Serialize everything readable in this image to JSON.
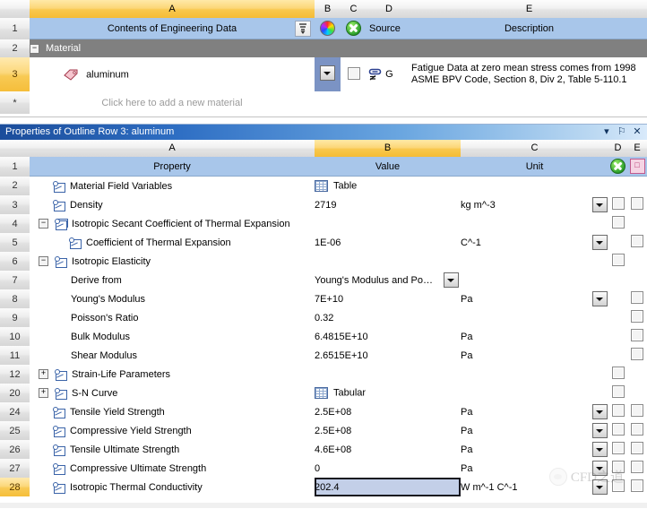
{
  "top_grid": {
    "column_headers": [
      "",
      "A",
      "B",
      "C",
      "D",
      "E"
    ],
    "row_numbers": [
      "1",
      "2",
      "3",
      "*"
    ],
    "header_row": {
      "a": "Contents of Engineering Data",
      "sort_icon": "sort-filter-icon",
      "b_icon": "color-wheel-icon",
      "c_icon": "green-x-circle-icon",
      "d": "Source",
      "e": "Description"
    },
    "group_row": {
      "label": "Material",
      "expander": "−"
    },
    "material_row": {
      "number": "3",
      "icon": "material-tag-icon",
      "name": "aluminum",
      "dropdown_icon": "dropdown-arrow-icon",
      "checkbox_icon": "checkbox-icon",
      "source_icon": "linked-source-icon",
      "source_text": "G",
      "description": "Fatigue Data at zero mean stress comes from 1998 ASME BPV Code, Section 8, Div 2, Table 5-110.1"
    },
    "add_row": {
      "number": "*",
      "label": "Click here to add a new material"
    }
  },
  "properties_panel": {
    "title": "Properties of Outline Row 3: aluminum",
    "title_buttons": [
      "▾",
      "⚐",
      "✕"
    ],
    "title_button_names": [
      "panel-menu-icon",
      "pin-icon",
      "close-icon"
    ],
    "column_headers": [
      "",
      "A",
      "B",
      "C",
      "D",
      "E"
    ],
    "selected_column": "B",
    "header_row": {
      "number": "1",
      "a": "Property",
      "b": "Value",
      "c": "Unit",
      "d_icon": "green-x-circle-icon",
      "e_icon": "pink-chart-icon"
    },
    "rows": [
      {
        "num": "2",
        "indent": 0,
        "expander": "",
        "icon": "property-chart-icon",
        "property": "Material Field Variables",
        "value": "Table",
        "value_icon": "table-icon",
        "unit": "",
        "unit_dropdown": false,
        "d_check": false,
        "e_check": false,
        "selected": false
      },
      {
        "num": "3",
        "indent": 0,
        "expander": "",
        "icon": "property-chart-icon",
        "property": "Density",
        "value": "2719",
        "value_icon": "",
        "unit": "kg m^-3",
        "unit_dropdown": true,
        "d_check": true,
        "e_check": true,
        "selected": false
      },
      {
        "num": "4",
        "indent": 0,
        "expander": "−",
        "icon": "property-chart-double-icon",
        "property": "Isotropic Secant Coefficient of Thermal Expansion",
        "value": "",
        "value_icon": "",
        "unit": "",
        "unit_dropdown": false,
        "d_check": true,
        "e_check": false,
        "selected": false
      },
      {
        "num": "5",
        "indent": 1,
        "expander": "",
        "icon": "property-chart-icon",
        "property": "Coefficient of Thermal Expansion",
        "value": "1E-06",
        "value_icon": "",
        "unit": "C^-1",
        "unit_dropdown": true,
        "d_check": false,
        "e_check": true,
        "selected": false
      },
      {
        "num": "6",
        "indent": 0,
        "expander": "−",
        "icon": "property-chart-icon",
        "property": "Isotropic Elasticity",
        "value": "",
        "value_icon": "",
        "unit": "",
        "unit_dropdown": false,
        "d_check": true,
        "e_check": false,
        "selected": false
      },
      {
        "num": "7",
        "indent": 2,
        "expander": "",
        "icon": "",
        "property": "Derive from",
        "value": "Young's Modulus and Po…",
        "value_icon": "",
        "unit": "",
        "unit_dropdown": false,
        "d_check": false,
        "e_check": false,
        "selected": false,
        "value_combo": true
      },
      {
        "num": "8",
        "indent": 2,
        "expander": "",
        "icon": "",
        "property": "Young's Modulus",
        "value": "7E+10",
        "value_icon": "",
        "unit": "Pa",
        "unit_dropdown": true,
        "d_check": false,
        "e_check": true,
        "selected": false
      },
      {
        "num": "9",
        "indent": 2,
        "expander": "",
        "icon": "",
        "property": "Poisson's Ratio",
        "value": "0.32",
        "value_icon": "",
        "unit": "",
        "unit_dropdown": false,
        "d_check": false,
        "e_check": true,
        "selected": false
      },
      {
        "num": "10",
        "indent": 2,
        "expander": "",
        "icon": "",
        "property": "Bulk Modulus",
        "value": "6.4815E+10",
        "value_icon": "",
        "unit": "Pa",
        "unit_dropdown": false,
        "d_check": false,
        "e_check": true,
        "selected": false
      },
      {
        "num": "11",
        "indent": 2,
        "expander": "",
        "icon": "",
        "property": "Shear Modulus",
        "value": "2.6515E+10",
        "value_icon": "",
        "unit": "Pa",
        "unit_dropdown": false,
        "d_check": false,
        "e_check": true,
        "selected": false
      },
      {
        "num": "12",
        "indent": 0,
        "expander": "+",
        "icon": "property-chart-icon",
        "property": "Strain-Life Parameters",
        "value": "",
        "value_icon": "",
        "unit": "",
        "unit_dropdown": false,
        "d_check": true,
        "e_check": false,
        "selected": false
      },
      {
        "num": "20",
        "indent": 0,
        "expander": "+",
        "icon": "property-chart-icon",
        "property": "S-N Curve",
        "value": "Tabular",
        "value_icon": "table-icon",
        "unit": "",
        "unit_dropdown": false,
        "d_check": true,
        "e_check": false,
        "selected": false
      },
      {
        "num": "24",
        "indent": 0,
        "expander": "",
        "icon": "property-chart-icon",
        "property": "Tensile Yield Strength",
        "value": "2.5E+08",
        "value_icon": "",
        "unit": "Pa",
        "unit_dropdown": true,
        "d_check": true,
        "e_check": true,
        "selected": false
      },
      {
        "num": "25",
        "indent": 0,
        "expander": "",
        "icon": "property-chart-icon",
        "property": "Compressive Yield Strength",
        "value": "2.5E+08",
        "value_icon": "",
        "unit": "Pa",
        "unit_dropdown": true,
        "d_check": true,
        "e_check": true,
        "selected": false
      },
      {
        "num": "26",
        "indent": 0,
        "expander": "",
        "icon": "property-chart-icon",
        "property": "Tensile Ultimate Strength",
        "value": "4.6E+08",
        "value_icon": "",
        "unit": "Pa",
        "unit_dropdown": true,
        "d_check": true,
        "e_check": true,
        "selected": false
      },
      {
        "num": "27",
        "indent": 0,
        "expander": "",
        "icon": "property-chart-icon",
        "property": "Compressive Ultimate Strength",
        "value": "0",
        "value_icon": "",
        "unit": "Pa",
        "unit_dropdown": true,
        "d_check": true,
        "e_check": true,
        "selected": false
      },
      {
        "num": "28",
        "indent": 0,
        "expander": "",
        "icon": "property-chart-icon",
        "property": "Isotropic Thermal Conductivity",
        "value": "202.4",
        "value_icon": "",
        "unit": "W m^-1 C^-1",
        "unit_dropdown": true,
        "d_check": true,
        "e_check": true,
        "selected": true
      }
    ]
  },
  "watermark": {
    "text": "CFD之道",
    "logo": "cfd-logo-icon"
  },
  "colors": {
    "selected_column_header": "#f5c13c",
    "header_row_blue": "#a8c6ea",
    "group_row_gray": "#808080",
    "title_bar_blue": "#1b4d9b",
    "selected_cell": "#c3cfe8"
  }
}
